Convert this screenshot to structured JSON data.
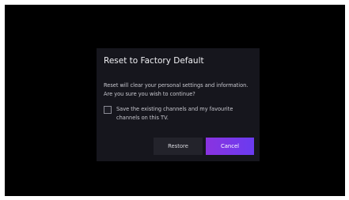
{
  "dialog": {
    "title": "Reset to Factory Default",
    "message": "Reset will clear your personal settings and information. Are you sure you wish to continue?",
    "checkbox": {
      "label": "Save the existing channels and my favourite channels on this TV.",
      "checked": false
    },
    "buttons": {
      "restore": "Restore",
      "cancel": "Cancel"
    }
  },
  "colors": {
    "screen_background": "#000000",
    "dialog_background": "#16161d",
    "cancel_gradient_start": "#8a33e0",
    "cancel_gradient_end": "#6a3bf0",
    "restore_background": "#23232b"
  }
}
